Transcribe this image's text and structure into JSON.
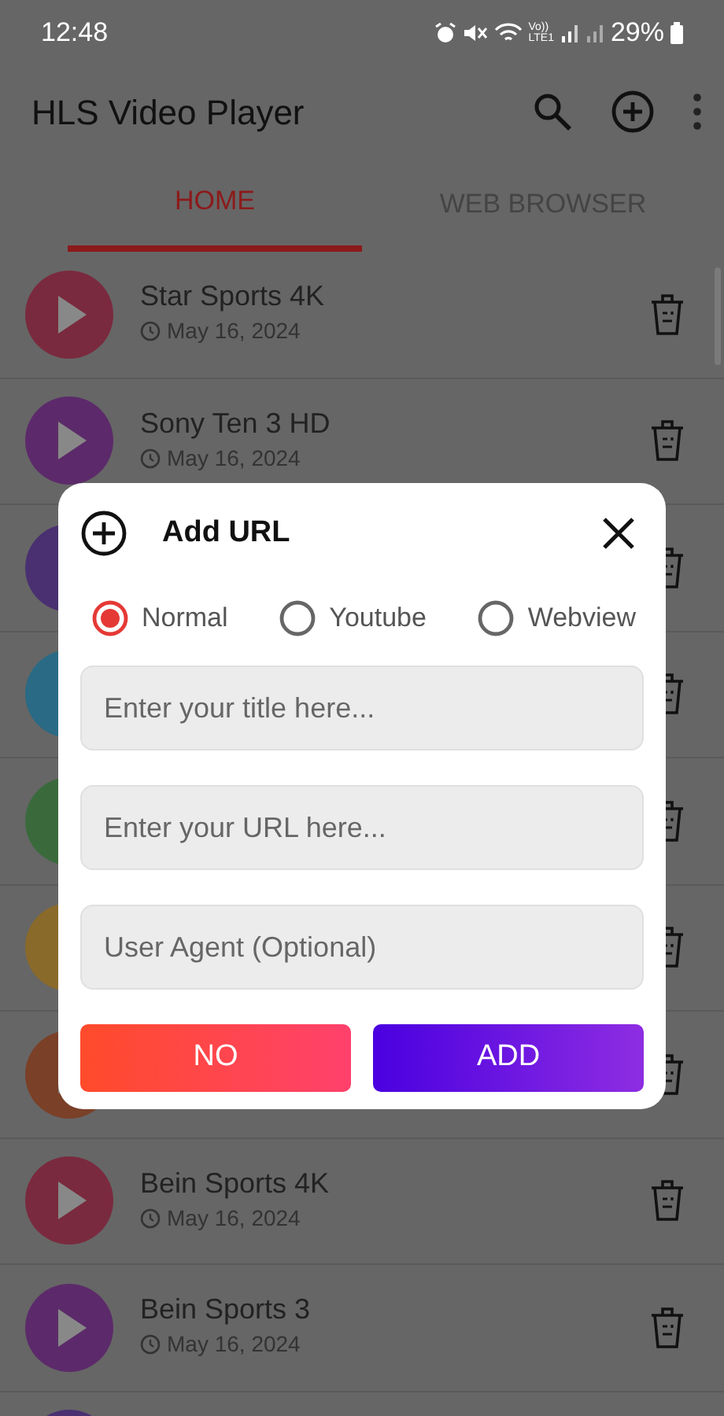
{
  "status_bar": {
    "time": "12:48",
    "network_top": "Vo))",
    "network_bottom": "LTE1",
    "battery": "29%"
  },
  "app_bar": {
    "title": "HLS Video Player"
  },
  "tabs": [
    {
      "label": "HOME",
      "selected": true
    },
    {
      "label": "WEB BROWSER",
      "selected": false
    }
  ],
  "channels": [
    {
      "kind": "full",
      "title": "Star Sports 4K",
      "date": "May 16, 2024",
      "color": "#7a2a3e"
    },
    {
      "kind": "full",
      "title": "Sony Ten 3 HD",
      "date": "May 16, 2024",
      "color": "#5c2a6a"
    },
    {
      "kind": "covered",
      "color": "#4a3070"
    },
    {
      "kind": "covered",
      "color": "#2a6a85"
    },
    {
      "kind": "covered",
      "color": "#3a6a3c"
    },
    {
      "kind": "covered",
      "color": "#8a6a2a"
    },
    {
      "kind": "covered",
      "color": "#7a4028"
    },
    {
      "kind": "full",
      "title": "Bein Sports 4K",
      "date": "May 16, 2024",
      "color": "#7a2a3e"
    },
    {
      "kind": "full",
      "title": "Bein Sports 3",
      "date": "May 16, 2024",
      "color": "#5c2a6a"
    },
    {
      "kind": "edge",
      "color": "#4a3070"
    }
  ],
  "dialog": {
    "title": "Add URL",
    "modes": [
      {
        "label": "Normal",
        "selected": true
      },
      {
        "label": "Youtube",
        "selected": false
      },
      {
        "label": "Webview",
        "selected": false
      }
    ],
    "fields": [
      {
        "placeholder": "Enter your title here..."
      },
      {
        "placeholder": "Enter your URL here..."
      },
      {
        "placeholder": "User Agent (Optional)"
      }
    ],
    "buttons": [
      {
        "label": "NO",
        "kind": "cancel"
      },
      {
        "label": "ADD",
        "kind": "confirm"
      }
    ]
  }
}
